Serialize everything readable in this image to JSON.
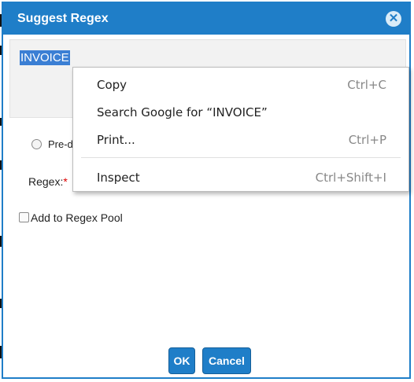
{
  "dialog": {
    "title": "Suggest Regex",
    "close_icon": "close-circle-icon",
    "selected_text": "INVOICE",
    "radio_label": "Pre-d",
    "regex_label": "Regex:",
    "required_mark": "*",
    "regex_value": "",
    "checkbox_label": "Add to Regex Pool",
    "ok_label": "OK",
    "cancel_label": "Cancel"
  },
  "context_menu": {
    "items": [
      {
        "label": "Copy",
        "shortcut": "Ctrl+C"
      },
      {
        "label": "Search Google for “INVOICE”",
        "shortcut": ""
      },
      {
        "label": "Print...",
        "shortcut": "Ctrl+P"
      },
      {
        "label": "Inspect",
        "shortcut": "Ctrl+Shift+I"
      }
    ]
  },
  "colors": {
    "title_bar": "#1f7ec8",
    "selection": "#3b7fd4",
    "button": "#1f7ec8",
    "required": "#dd0000"
  }
}
